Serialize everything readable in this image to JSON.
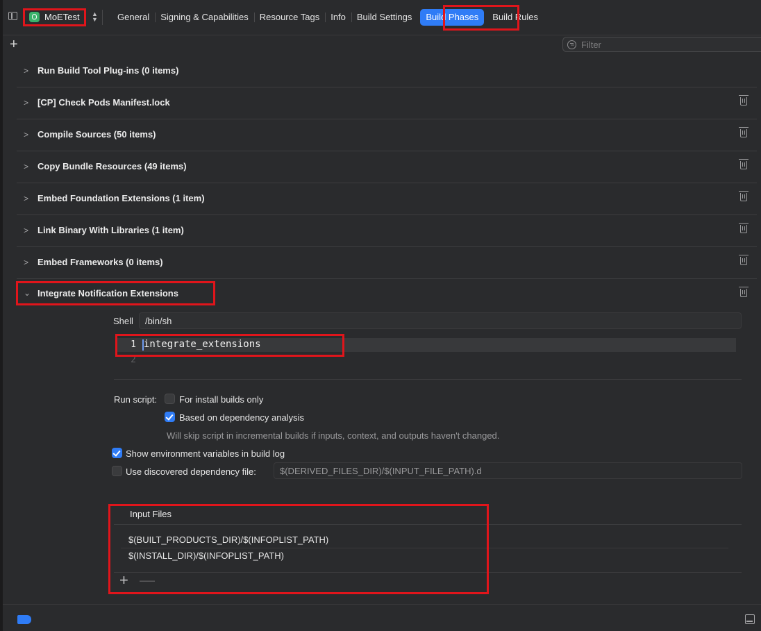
{
  "target": {
    "name": "MoETest"
  },
  "tabs": [
    {
      "label": "General"
    },
    {
      "label": "Signing & Capabilities"
    },
    {
      "label": "Resource Tags"
    },
    {
      "label": "Info"
    },
    {
      "label": "Build Settings"
    },
    {
      "label": "Build Phases",
      "active": true
    },
    {
      "label": "Build Rules"
    }
  ],
  "toolbar": {
    "add_label": "+",
    "filter_placeholder": "Filter"
  },
  "phases": [
    {
      "title": "Run Build Tool Plug-ins (0 items)",
      "deletable": false
    },
    {
      "title": "[CP] Check Pods Manifest.lock"
    },
    {
      "title": "Compile Sources (50 items)"
    },
    {
      "title": "Copy Bundle Resources (49 items)"
    },
    {
      "title": "Embed Foundation Extensions (1 item)"
    },
    {
      "title": "Link Binary With Libraries (1 item)"
    },
    {
      "title": "Embed Frameworks (0 items)"
    }
  ],
  "expanded_phase": {
    "title": "Integrate Notification Extensions",
    "shell_label": "Shell",
    "shell_value": "/bin/sh",
    "script_lines": [
      {
        "number": "1",
        "code": "integrate_extensions"
      },
      {
        "number": "2",
        "code": ""
      }
    ],
    "run_script_label": "Run script:",
    "install_builds_label": "For install builds only",
    "install_builds_checked": false,
    "dependency_analysis_label": "Based on dependency analysis",
    "dependency_analysis_checked": true,
    "dependency_hint": "Will skip script in incremental builds if inputs, context, and outputs haven't changed.",
    "show_env_label": "Show environment variables in build log",
    "show_env_checked": true,
    "use_dep_file_label": "Use discovered dependency file:",
    "use_dep_file_checked": false,
    "dep_file_placeholder": "$(DERIVED_FILES_DIR)/$(INPUT_FILE_PATH).d",
    "input_files_title": "Input Files",
    "input_files": [
      "$(BUILT_PRODUCTS_DIR)/$(INFOPLIST_PATH)",
      "$(INSTALL_DIR)/$(INFOPLIST_PATH)"
    ],
    "add_file": "+",
    "remove_file": "—"
  },
  "colors": {
    "accent": "#2f7cf6",
    "annotation": "#e0151b",
    "background": "#2a2b2d"
  }
}
